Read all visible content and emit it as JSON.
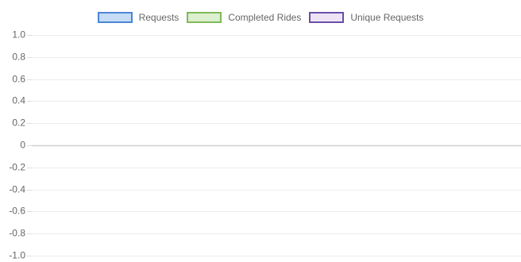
{
  "chart_data": {
    "type": "line",
    "title": "",
    "xlabel": "",
    "ylabel": "",
    "ylim": [
      -1.0,
      1.0
    ],
    "yticks": [
      "1.0",
      "0.8",
      "0.6",
      "0.4",
      "0.2",
      "0",
      "-0.2",
      "-0.4",
      "-0.6",
      "-0.8",
      "-1.0"
    ],
    "categories": [],
    "grid": true,
    "legend_position": "top-center",
    "series": [
      {
        "name": "Requests",
        "values": [],
        "fill": "#c6dbf5",
        "stroke": "#4a86d4"
      },
      {
        "name": "Completed Rides",
        "values": [],
        "fill": "#dcefcf",
        "stroke": "#7fba56"
      },
      {
        "name": "Unique Requests",
        "values": [],
        "fill": "#ece4f5",
        "stroke": "#6a4ea8"
      }
    ]
  }
}
